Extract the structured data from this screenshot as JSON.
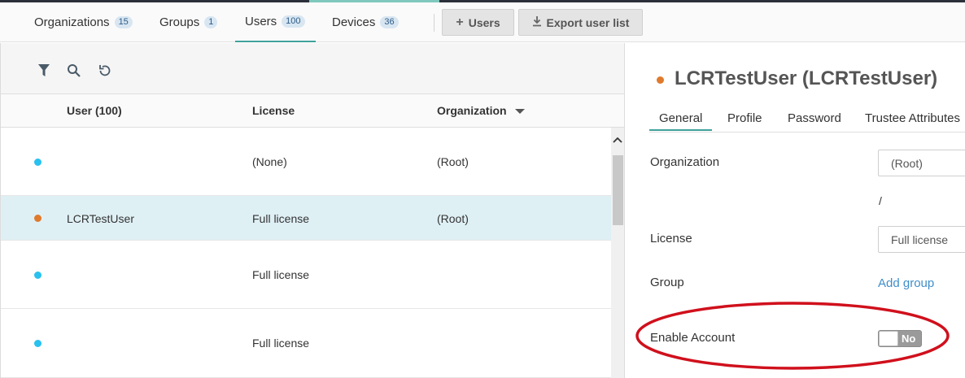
{
  "nav_tabs": [
    {
      "label": "Organizations",
      "count": "15",
      "active": false
    },
    {
      "label": "Groups",
      "count": "1",
      "active": false
    },
    {
      "label": "Users",
      "count": "100",
      "active": true
    },
    {
      "label": "Devices",
      "count": "36",
      "active": false
    }
  ],
  "header_buttons": {
    "add_users": {
      "icon": "plus-icon",
      "label": "Users"
    },
    "export": {
      "icon": "download-icon",
      "label": "Export user list"
    }
  },
  "toolbar_icons": [
    "filter-icon",
    "search-icon",
    "refresh-icon"
  ],
  "table": {
    "columns": {
      "user": "User (100)",
      "license": "License",
      "organization": "Organization"
    },
    "sort_column": "organization",
    "rows": [
      {
        "user": "",
        "license": "(None)",
        "organization": "(Root)",
        "status_color": "#29c1ef",
        "selected": false
      },
      {
        "user": "LCRTestUser",
        "license": "Full license",
        "organization": "(Root)",
        "status_color": "#e07a2c",
        "selected": true
      },
      {
        "user": "",
        "license": "Full license",
        "organization": "",
        "status_color": "#29c1ef",
        "selected": false
      },
      {
        "user": "",
        "license": "Full license",
        "organization": "",
        "status_color": "#29c1ef",
        "selected": false
      }
    ]
  },
  "detail": {
    "title": "LCRTestUser (LCRTestUser)",
    "status_color": "#e07a2c",
    "tabs": [
      {
        "label": "General",
        "active": true
      },
      {
        "label": "Profile",
        "active": false
      },
      {
        "label": "Password",
        "active": false
      },
      {
        "label": "Trustee Attributes",
        "active": false
      }
    ],
    "fields": {
      "organization": {
        "label": "Organization",
        "value": "(Root)",
        "path": "/"
      },
      "license": {
        "label": "License",
        "value": "Full license"
      },
      "group": {
        "label": "Group",
        "action": "Add group"
      },
      "enable_account": {
        "label": "Enable Account",
        "toggle_label": "No",
        "enabled": false
      }
    }
  },
  "colors": {
    "accent": "#3fa19b",
    "link": "#3f8ec9",
    "annotation": "#d0101c",
    "selected_row": "#dff0f5"
  }
}
